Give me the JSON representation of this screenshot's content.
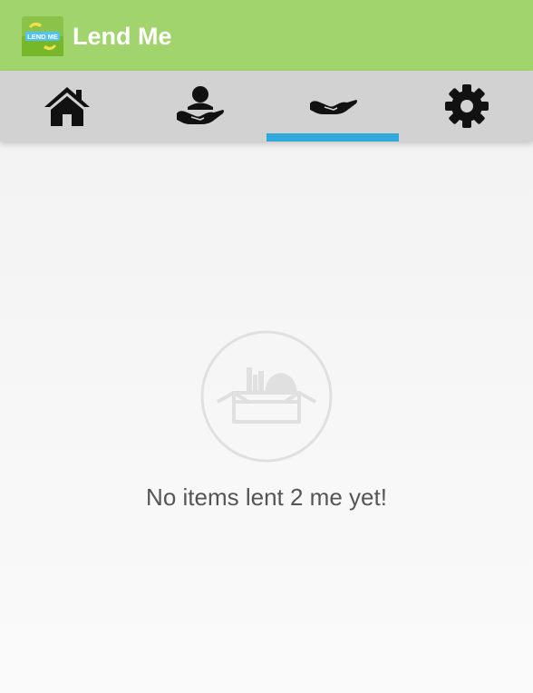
{
  "app": {
    "title": "Lend Me",
    "logo_text": "LEND ME",
    "colors": {
      "appbar": "#a2d46e",
      "tabbar": "#d2d2d2",
      "indicator": "#2fa8dc",
      "icon": "#111111",
      "empty_text": "#555555"
    }
  },
  "tabs": [
    {
      "icon": "home-icon",
      "selected": false
    },
    {
      "icon": "person-in-hand-icon",
      "selected": false
    },
    {
      "icon": "open-hand-icon",
      "selected": true
    },
    {
      "icon": "gear-icon",
      "selected": false
    }
  ],
  "empty_state": {
    "icon": "empty-box-icon",
    "message": "No items lent 2 me yet!"
  }
}
